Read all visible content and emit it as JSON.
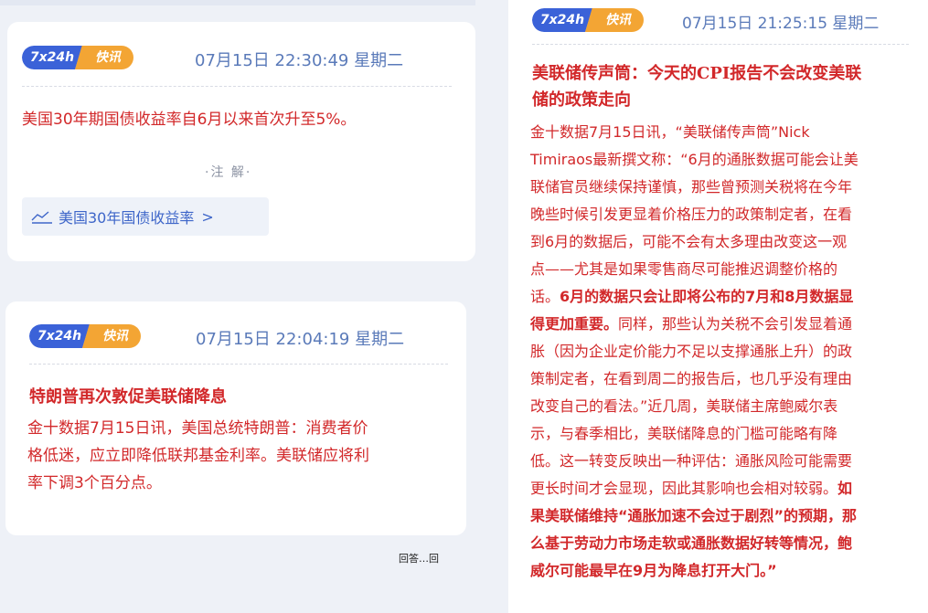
{
  "badge": {
    "left_label": "7x24h",
    "right_label": "快讯"
  },
  "cards": [
    {
      "timestamp": "07月15日 22:30:49 星期二",
      "text": "美国30年期国债收益率自6月以来首次升至5%。",
      "note": "·注 解·",
      "link_label": "美国30年国债收益率",
      "link_arrow": ">"
    },
    {
      "timestamp": "07月15日 22:04:19 星期二",
      "title": "特朗普再次敦促美联储降息",
      "body_lines": [
        "金十数据7月15日讯，美国总统特朗普：消费者价",
        "格低迷，应立即降低联邦基金利率。美联储应将利",
        "率下调3个百分点。"
      ]
    },
    {
      "timestamp": "07月15日 21:25:15 星期二",
      "title_lines": [
        "美联储传声筒：今天的CPI报告不会改变美联",
        "储的政策走向"
      ],
      "body_lines": [
        [
          {
            "t": "金十数据7月15日讯，“美联储传声筒”Nick"
          }
        ],
        [
          {
            "t": "Timiraos最新撰文称：“6月的通胀数据可能会让美"
          }
        ],
        [
          {
            "t": "联储官员继续保持谨慎，那些曾预测关税将在今年"
          }
        ],
        [
          {
            "t": "晚些时候引发更显着价格压力的政策制定者，在看"
          }
        ],
        [
          {
            "t": "到6月的数据后，可能不会有太多理由改变这一观"
          }
        ],
        [
          {
            "t": "点——尤其是如果零售商尽可能推迟调整价格的"
          }
        ],
        [
          {
            "t": "话。"
          },
          {
            "t": "6月的数据只会让即将公布的7月和8月数据显",
            "b": true
          }
        ],
        [
          {
            "t": "得更加重要。",
            "b": true
          },
          {
            "t": "同样，那些认为关税不会引发显着通"
          }
        ],
        [
          {
            "t": "胀（因为企业定价能力不足以支撑通胀上升）的政"
          }
        ],
        [
          {
            "t": "策制定者，在看到周二的报告后，也几乎没有理由"
          }
        ],
        [
          {
            "t": "改变自己的看法。”近几周，美联储主席鲍威尔表"
          }
        ],
        [
          {
            "t": "示，与春季相比，美联储降息的门槛可能略有降"
          }
        ],
        [
          {
            "t": "低。这一转变反映出一种评估：通胀风险可能需要"
          }
        ],
        [
          {
            "t": "更长时间才会显现，因此其影响也会相对较弱。"
          },
          {
            "t": "如",
            "b": true
          }
        ],
        [
          {
            "t": "果美联储维持“通胀加速不会过于剧烈”的预期，那",
            "b": true
          }
        ],
        [
          {
            "t": "么基于劳动力市场走软或通胀数据好转等情况，鲍",
            "b": true
          }
        ],
        [
          {
            "t": "威尔可能最早在9月为降息打开大门。”",
            "b": true
          }
        ]
      ]
    }
  ],
  "fragment_text": "回答…回",
  "colors": {
    "accent_red": "#d2282a",
    "badge_blue": "#3b62d8",
    "badge_orange": "#f3a534",
    "timestamp_blue": "#5a7ab9",
    "link_blue": "#3e66c9"
  },
  "icons": {
    "link_icon": "line-chart-icon"
  }
}
